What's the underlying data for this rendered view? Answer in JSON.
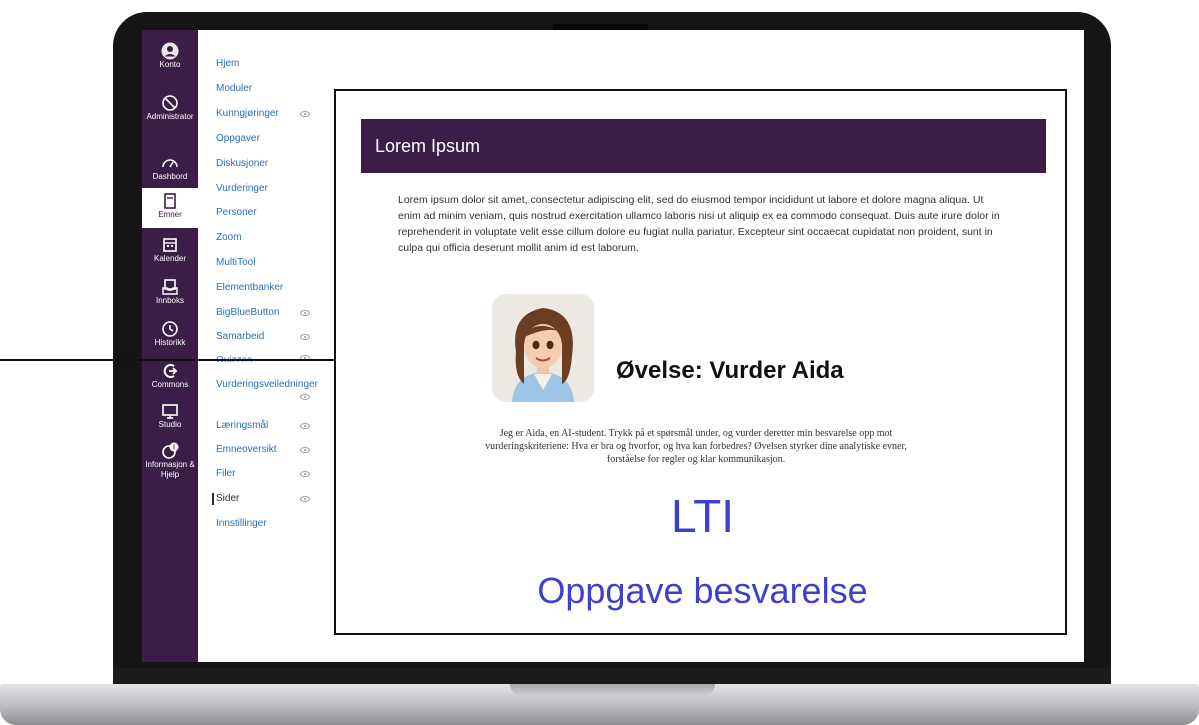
{
  "colors": {
    "brand_purple": "#3b1d47",
    "link_blue": "#2b6fb5",
    "lti_blue": "#3f3fcf"
  },
  "global_nav": [
    {
      "label": "Konto",
      "icon": "account-icon"
    },
    {
      "label": "Administrator",
      "icon": "admin-icon"
    },
    {
      "label": "Dashbord",
      "icon": "dashboard-icon"
    },
    {
      "label": "Emner",
      "icon": "courses-icon",
      "active": true
    },
    {
      "label": "Kalender",
      "icon": "calendar-icon"
    },
    {
      "label": "Innboks",
      "icon": "inbox-icon"
    },
    {
      "label": "Historikk",
      "icon": "history-icon"
    },
    {
      "label": "Commons",
      "icon": "commons-icon"
    },
    {
      "label": "Studio",
      "icon": "studio-icon"
    },
    {
      "label": "Informasjon & Hjelp",
      "icon": "help-icon"
    }
  ],
  "course_nav": [
    {
      "label": "Hjem"
    },
    {
      "label": "Moduler"
    },
    {
      "label": "Kunngjøringer",
      "hidden": true
    },
    {
      "label": "Oppgaver"
    },
    {
      "label": "Diskusjoner"
    },
    {
      "label": "Vurderinger"
    },
    {
      "label": "Personer"
    },
    {
      "label": "Zoom"
    },
    {
      "label": "MultiTool"
    },
    {
      "label": "Elementbanker"
    },
    {
      "label": "BigBlueButton",
      "hidden": true
    },
    {
      "label": "Samarbeid",
      "hidden": true
    },
    {
      "label": "Quizzes",
      "hidden": true
    },
    {
      "label": "Vurderingsveiledninger",
      "hidden": true
    },
    {
      "label": "Læringsmål",
      "hidden": true
    },
    {
      "label": "Emneoversikt",
      "hidden": true
    },
    {
      "label": "Filer",
      "hidden": true
    },
    {
      "label": "Sider",
      "hidden": true,
      "current": true
    },
    {
      "label": "Innstillinger"
    }
  ],
  "page": {
    "banner_title": "Lorem Ipsum",
    "lorem": "Lorem ipsum dolor sit amet, consectetur adipiscing elit, sed do eiusmod tempor incididunt ut labore et dolore magna aliqua. Ut enim ad minim veniam, quis nostrud exercitation ullamco laboris nisi ut aliquip ex ea commodo consequat. Duis aute irure dolor in reprehenderit in voluptate velit esse cillum dolore eu fugiat nulla pariatur. Excepteur sint occaecat cupidatat non proident, sunt in culpa qui officia deserunt mollit anim id est laborum.",
    "exercise_title": "Øvelse: Vurder Aida",
    "intro": "Jeg er Aida, en AI-student. Trykk på et spørsmål under, og vurder deretter min besvarelse opp mot vurderingskriteriene: Hva er bra og hvorfor, og hva kan forbedres? Øvelsen styrker dine analytiske evner, forståelse for regler og klar kommunikasjon.",
    "lti_label": "LTI",
    "lti_subtitle": "Oppgave besvarelse"
  }
}
